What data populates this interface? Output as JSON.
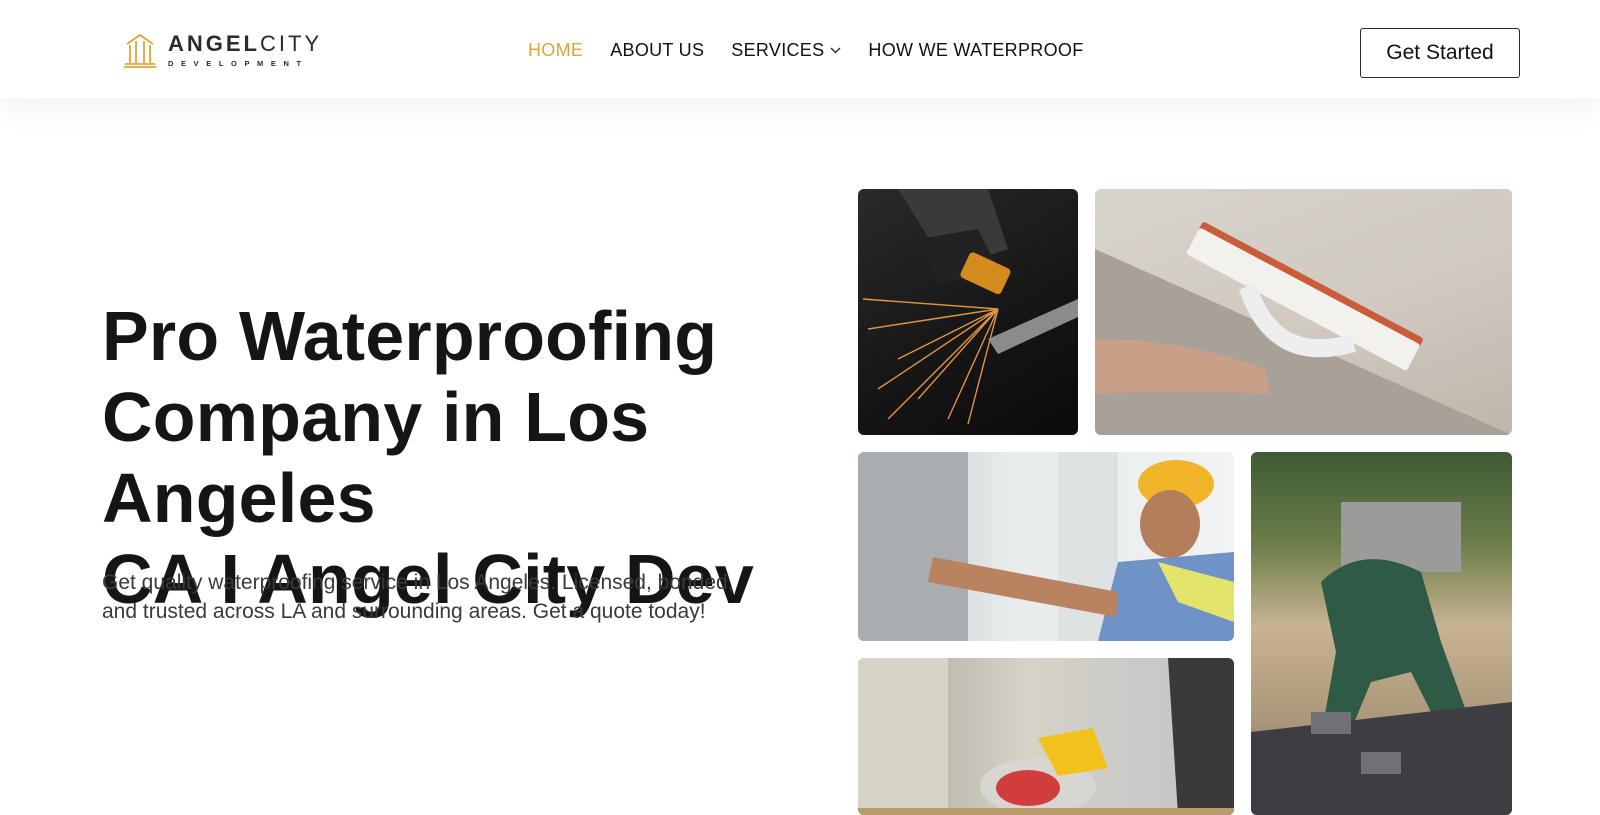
{
  "brand": {
    "name_part1": "ANGEL",
    "name_part2": "CITY",
    "subtitle": "DEVELOPMENT",
    "accent_color": "#e0a43a"
  },
  "nav": {
    "items": [
      {
        "label": "HOME",
        "active": true
      },
      {
        "label": "ABOUT US",
        "active": false
      },
      {
        "label": "SERVICES",
        "active": false,
        "has_dropdown": true
      },
      {
        "label": "HOW WE WATERPROOF",
        "active": false
      }
    ]
  },
  "cta": {
    "label": "Get Started"
  },
  "hero": {
    "title_lines": [
      "Pro Waterproofing",
      "Company in Los Angeles",
      "CA I Angel City Dev"
    ],
    "description_lines": [
      "Get quality waterproofing service in Los Angeles. Licensed, bonded,",
      "and trusted across LA and surrounding areas. Get a quote today!"
    ]
  },
  "gallery": {
    "images": [
      {
        "subject": "angle-grinder-sparks-photo"
      },
      {
        "subject": "plaster-trowel-wall-photo"
      },
      {
        "subject": "worker-hardhat-installing-panel-photo"
      },
      {
        "subject": "worker-laying-pavers-photo"
      },
      {
        "subject": "circular-saw-cutting-photo"
      }
    ]
  },
  "icons": {
    "logo": "building-columns-logo-icon",
    "dropdown": "chevron-down-icon"
  }
}
